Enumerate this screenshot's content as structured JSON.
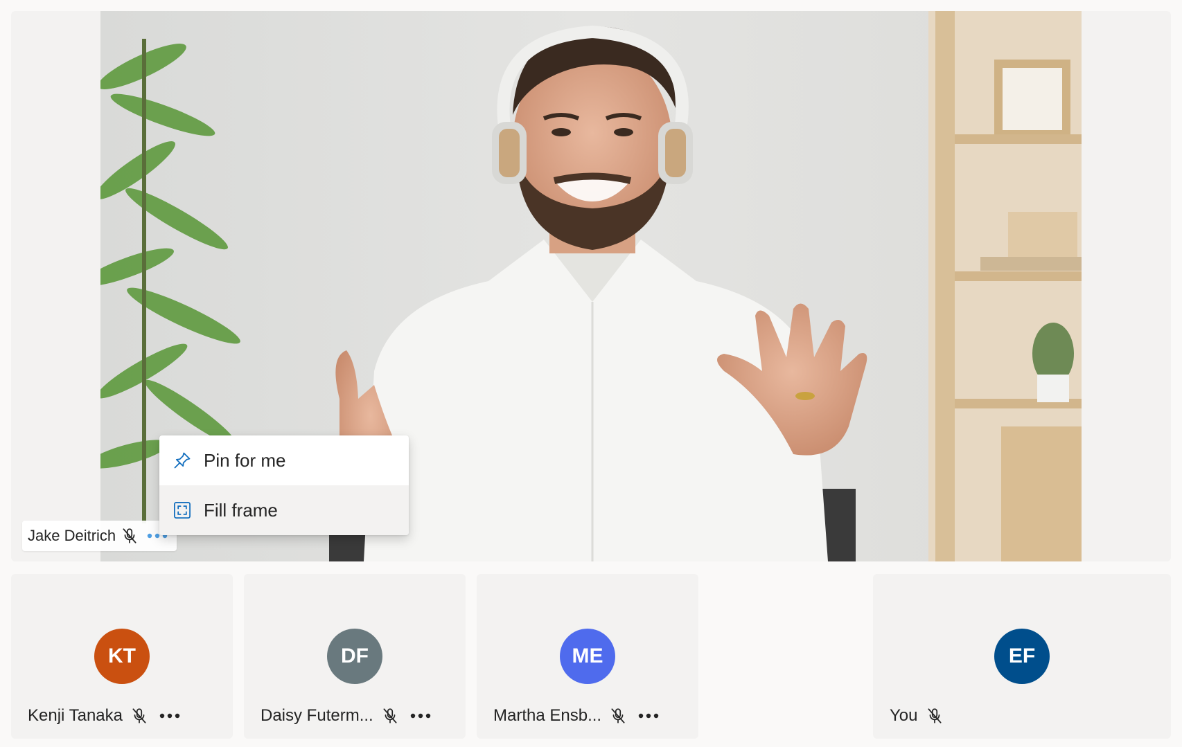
{
  "stage": {
    "participant_name": "Jake Deitrich",
    "mic_icon": "mic-off-icon",
    "more_icon": "more-options-icon"
  },
  "context_menu": {
    "items": [
      {
        "label": "Pin for me",
        "icon": "pin-icon"
      },
      {
        "label": "Fill frame",
        "icon": "fill-frame-icon"
      }
    ]
  },
  "tiles": [
    {
      "initials": "KT",
      "name": "Kenji Tanaka",
      "color": "#ca5010",
      "muted": true,
      "has_more": true
    },
    {
      "initials": "DF",
      "name": "Daisy Futerm...",
      "color": "#69797e",
      "muted": true,
      "has_more": true
    },
    {
      "initials": "ME",
      "name": "Martha Ensb...",
      "color": "#4f6bed",
      "muted": true,
      "has_more": true
    },
    {
      "initials": "EF",
      "name": "You",
      "color": "#004e8c",
      "muted": true,
      "has_more": false
    }
  ],
  "colors": {
    "accent": "#0f6cbd",
    "more_active": "#4f9fe3",
    "tile_bg": "#f3f2f1",
    "page_bg": "#faf9f8"
  }
}
